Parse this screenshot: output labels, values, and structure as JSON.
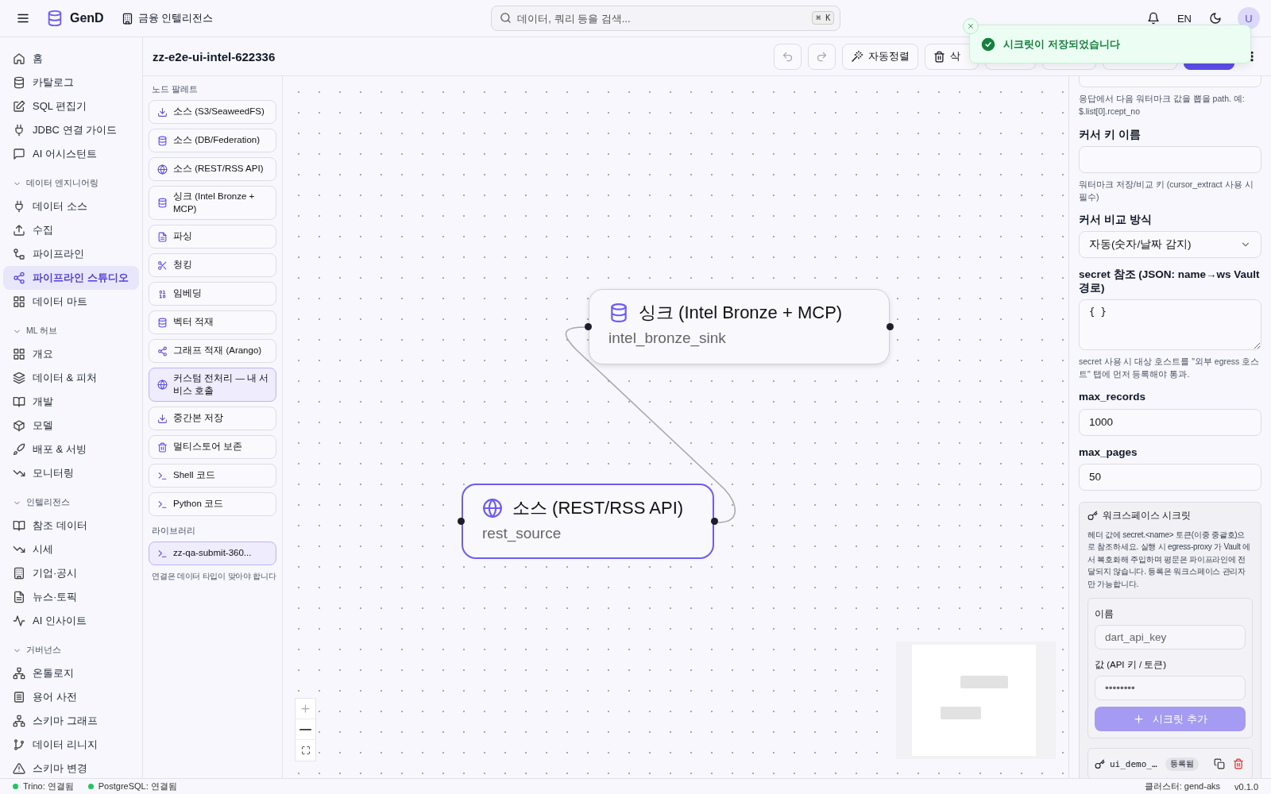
{
  "header": {
    "app_name": "GenD",
    "workspace": "금융 인텔리전스",
    "search": {
      "placeholder": "데이터, 쿼리 등을 검색...",
      "shortcut": "⌘ K"
    },
    "language": "EN",
    "avatar": "U"
  },
  "toast": {
    "message": "시크릿이 저장되었습니다"
  },
  "sidebar": {
    "sections": [
      {
        "items": [
          {
            "label": "홈",
            "selected": false
          },
          {
            "label": "카탈로그",
            "selected": false
          },
          {
            "label": "SQL 편집기",
            "selected": false
          },
          {
            "label": "JDBC 연결 가이드",
            "selected": false
          },
          {
            "label": "AI 어시스턴트",
            "selected": false
          }
        ]
      },
      {
        "title": "데이터 엔지니어링",
        "expanded": true,
        "items": [
          {
            "label": "데이터 소스",
            "selected": false
          },
          {
            "label": "수집",
            "selected": false
          },
          {
            "label": "파이프라인",
            "selected": false
          },
          {
            "label": "파이프라인 스튜디오",
            "selected": true
          },
          {
            "label": "데이터 마트",
            "selected": false
          }
        ]
      },
      {
        "title": "ML 허브",
        "expanded": true,
        "items": [
          {
            "label": "개요",
            "selected": false
          },
          {
            "label": "데이터 & 피처",
            "selected": false
          },
          {
            "label": "개발",
            "selected": false
          },
          {
            "label": "모델",
            "selected": false
          },
          {
            "label": "배포 & 서빙",
            "selected": false
          },
          {
            "label": "모니터링",
            "selected": false
          }
        ]
      },
      {
        "title": "인텔리전스",
        "expanded": true,
        "items": [
          {
            "label": "참조 데이터",
            "selected": false
          },
          {
            "label": "시세",
            "selected": false
          },
          {
            "label": "기업·공시",
            "selected": false
          },
          {
            "label": "뉴스·토픽",
            "selected": false
          },
          {
            "label": "AI 인사이트",
            "selected": false
          }
        ]
      },
      {
        "title": "거버넌스",
        "expanded": true,
        "items": [
          {
            "label": "온톨로지",
            "selected": false
          },
          {
            "label": "용어 사전",
            "selected": false
          },
          {
            "label": "스키마 그래프",
            "selected": false
          },
          {
            "label": "데이터 리니지",
            "selected": false
          },
          {
            "label": "스키마 변경",
            "selected": false
          }
        ]
      }
    ]
  },
  "toolbar": {
    "title": "zz-e2e-ui-intel-622336",
    "buttons": [
      {
        "kind": "undo",
        "disabled": true
      },
      {
        "kind": "redo",
        "disabled": true
      },
      {
        "kind": "auto_layout",
        "label": "자동정렬",
        "disabled": false
      },
      {
        "kind": "delete",
        "label": "삭",
        "disabled": false
      },
      {
        "kind": "hidden"
      },
      {
        "kind": "hidden"
      },
      {
        "kind": "hidden"
      },
      {
        "kind": "primary"
      },
      {
        "kind": "more"
      }
    ]
  },
  "palette": {
    "title": "노드 팔레트",
    "items": [
      {
        "label": "소스 (S3/SeaweedFS)",
        "kind": "builtin"
      },
      {
        "label": "소스 (DB/Federation)",
        "kind": "builtin"
      },
      {
        "label": "소스 (REST/RSS API)",
        "kind": "builtin"
      },
      {
        "label": "싱크 (Intel Bronze + MCP)",
        "kind": "builtin"
      },
      {
        "label": "파싱",
        "kind": "builtin"
      },
      {
        "label": "청킹",
        "kind": "builtin"
      },
      {
        "label": "임베딩",
        "kind": "builtin"
      },
      {
        "label": "벡터 적재",
        "kind": "builtin"
      },
      {
        "label": "그래프 적재 (Arango)",
        "kind": "builtin"
      },
      {
        "label": "커스텀 전처리 — 내 서비스 호출",
        "kind": "custom"
      },
      {
        "label": "중간본 저장",
        "kind": "builtin"
      },
      {
        "label": "멀티스토어 보존",
        "kind": "builtin"
      },
      {
        "label": "Shell 코드",
        "kind": "builtin"
      },
      {
        "label": "Python 코드",
        "kind": "builtin"
      }
    ],
    "library_title": "라이브러리",
    "library": [
      {
        "label": "zz-qa-submit-360...",
        "kind": "custom"
      }
    ],
    "note": "연결은 데이터 타입이 맞아야 합니다"
  },
  "canvas": {
    "nodes": [
      {
        "title": "싱크 (Intel Bronze + MCP)",
        "name": "intel_bronze_sink",
        "selected": false
      },
      {
        "title": "소스 (REST/RSS API)",
        "name": "rest_source",
        "selected": true
      }
    ]
  },
  "properties": {
    "fields": [
      {
        "kind": "text",
        "hint": "응답에서 다음 워터마크 값을 뽑을 path. 예: $.list[0].rcept_no"
      },
      {
        "kind": "text",
        "label": "커서 키 이름",
        "hint": "워터마크 저장/비교 키 (cursor_extract 사용 시 필수)"
      },
      {
        "kind": "select",
        "label": "커서 비교 방식",
        "value": "자동(숫자/날짜 감지)"
      },
      {
        "kind": "textarea",
        "label": "secret 참조 (JSON: name→ws Vault 경로)",
        "value": "{ }",
        "hint": "secret 사용 시 대상 호스트를 \"외부 egress 호스트\" 탭에 먼저 등록해야 통과."
      },
      {
        "kind": "text",
        "label": "max_records",
        "value": "1000"
      },
      {
        "kind": "text",
        "label": "max_pages",
        "value": "50"
      }
    ],
    "secrets": {
      "title": "워크스페이스 시크릿",
      "description": "헤더 값에 secret.<name> 토큰(이중 중괄호)으로 참조하세요. 실행 시 egress-proxy 가 Vault 에서 복호화해 주입하며 평문은 파이프라인에 전달되지 않습니다. 등록은 워크스페이스 관리자만 가능합니다.",
      "name_label": "이름",
      "name_placeholder": "dart_api_key",
      "value_label": "값 (API 키 / 토큰)",
      "value_placeholder": "••••••••",
      "add_button": "시크릿 추가",
      "add_disabled": true,
      "items": [
        {
          "name": "ui_demo_…",
          "status": "등록됨"
        }
      ]
    }
  },
  "status_bar": {
    "services": [
      {
        "label": "Trino: 연결됨",
        "connected": true
      },
      {
        "label": "PostgreSQL: 연결됨",
        "connected": true
      }
    ],
    "cluster": "클러스터: gend-aks",
    "version": "v0.1.0"
  }
}
